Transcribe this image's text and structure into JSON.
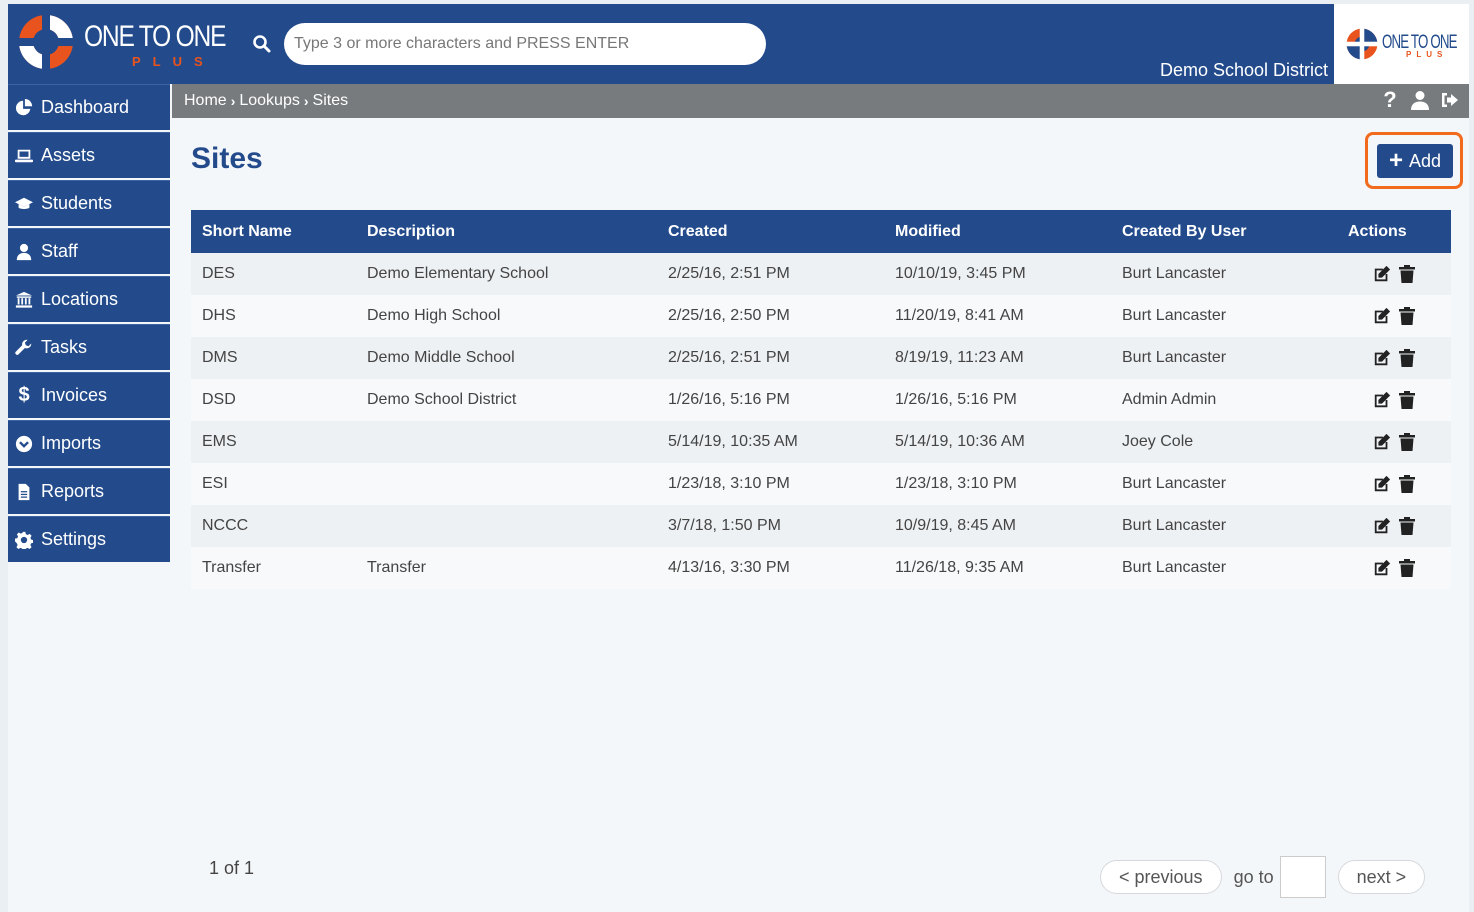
{
  "header": {
    "logo_text": "ONE TO ONE",
    "logo_plus": "PLUS",
    "search_placeholder": "Type 3 or more characters and PRESS ENTER",
    "district": "Demo School District",
    "client_logo_text": "ONE TO ONE",
    "client_logo_plus": "PLUS"
  },
  "sidebar": {
    "items": [
      {
        "label": "Dashboard",
        "icon": "pie-chart-icon"
      },
      {
        "label": "Assets",
        "icon": "laptop-icon"
      },
      {
        "label": "Students",
        "icon": "graduation-cap-icon"
      },
      {
        "label": "Staff",
        "icon": "user-icon"
      },
      {
        "label": "Locations",
        "icon": "institution-icon"
      },
      {
        "label": "Tasks",
        "icon": "wrench-icon"
      },
      {
        "label": "Invoices",
        "icon": "dollar-icon"
      },
      {
        "label": "Imports",
        "icon": "chevron-circle-down-icon"
      },
      {
        "label": "Reports",
        "icon": "document-icon"
      },
      {
        "label": "Settings",
        "icon": "gear-icon"
      }
    ]
  },
  "breadcrumb": [
    "Home",
    "Lookups",
    "Sites"
  ],
  "page": {
    "title": "Sites",
    "add_label": "Add"
  },
  "table": {
    "columns": [
      "Short Name",
      "Description",
      "Created",
      "Modified",
      "Created By User",
      "Actions"
    ],
    "rows": [
      [
        "DES",
        "Demo Elementary School",
        "2/25/16, 2:51 PM",
        "10/10/19, 3:45 PM",
        "Burt Lancaster"
      ],
      [
        "DHS",
        "Demo High School",
        "2/25/16, 2:50 PM",
        "11/20/19, 8:41 AM",
        "Burt Lancaster"
      ],
      [
        "DMS",
        "Demo Middle School",
        "2/25/16, 2:51 PM",
        "8/19/19, 11:23 AM",
        "Burt Lancaster"
      ],
      [
        "DSD",
        "Demo School District",
        "1/26/16, 5:16 PM",
        "1/26/16, 5:16 PM",
        "Admin Admin"
      ],
      [
        "EMS",
        "",
        "5/14/19, 10:35 AM",
        "5/14/19, 10:36 AM",
        "Joey Cole"
      ],
      [
        "ESI",
        "",
        "1/23/18, 3:10 PM",
        "1/23/18, 3:10 PM",
        "Burt Lancaster"
      ],
      [
        "NCCC",
        "",
        "3/7/18, 1:50 PM",
        "10/9/19, 8:45 AM",
        "Burt Lancaster"
      ],
      [
        "Transfer",
        "Transfer",
        "4/13/16, 3:30 PM",
        "11/26/18, 9:35 AM",
        "Burt Lancaster"
      ]
    ]
  },
  "pagination": {
    "count": "1 of 1",
    "previous": "< previous",
    "goto": "go to",
    "next": "next >"
  },
  "colors": {
    "primary": "#234b8c",
    "accent": "#e9531d",
    "highlight": "#f26a1b"
  }
}
